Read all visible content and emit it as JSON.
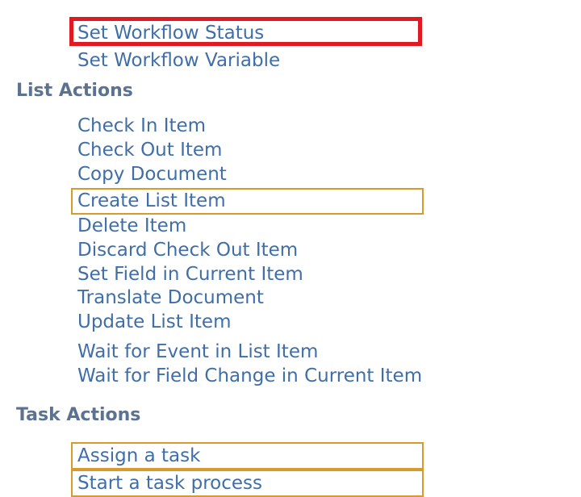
{
  "workflow_actions": {
    "items": [
      {
        "label": "Set Workflow Status"
      },
      {
        "label": "Set Workflow Variable"
      }
    ]
  },
  "list_actions": {
    "header": "List Actions",
    "items": [
      {
        "label": "Check In Item"
      },
      {
        "label": "Check Out Item"
      },
      {
        "label": "Copy Document"
      },
      {
        "label": "Create List Item"
      },
      {
        "label": "Delete Item"
      },
      {
        "label": "Discard Check Out Item"
      },
      {
        "label": "Set Field in Current Item"
      },
      {
        "label": "Translate Document"
      },
      {
        "label": "Update List Item"
      },
      {
        "label": "Wait for Event in List Item"
      },
      {
        "label": "Wait for Field Change in Current Item"
      }
    ]
  },
  "task_actions": {
    "header": "Task Actions",
    "items": [
      {
        "label": "Assign a task"
      },
      {
        "label": "Start a task process"
      }
    ]
  },
  "colors": {
    "action_text": "#3f6ea8",
    "header_text": "#5b7391",
    "highlight_red": "#e01a22",
    "highlight_yellow": "#d89a2c"
  }
}
